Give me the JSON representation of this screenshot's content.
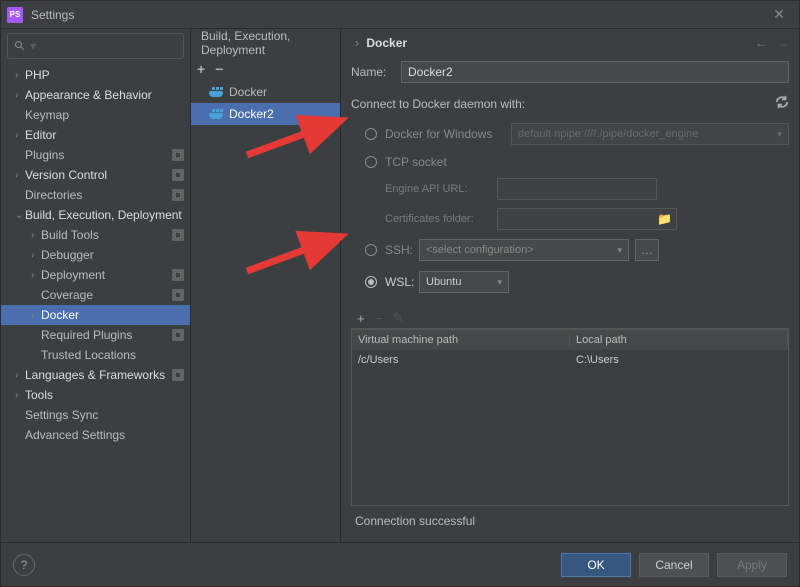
{
  "window": {
    "title": "Settings",
    "app_icon_text": "PS",
    "close_glyph": "✕"
  },
  "search": {
    "placeholder": ""
  },
  "tree": [
    {
      "label": "PHP",
      "level": 1,
      "arrow": "›",
      "bold": true,
      "scope": false
    },
    {
      "label": "Appearance & Behavior",
      "level": 1,
      "arrow": "›",
      "bold": true,
      "scope": false
    },
    {
      "label": "Keymap",
      "level": 1,
      "arrow": "",
      "bold": false,
      "scope": false
    },
    {
      "label": "Editor",
      "level": 1,
      "arrow": "›",
      "bold": true,
      "scope": false
    },
    {
      "label": "Plugins",
      "level": 1,
      "arrow": "",
      "bold": false,
      "scope": true
    },
    {
      "label": "Version Control",
      "level": 1,
      "arrow": "›",
      "bold": true,
      "scope": true
    },
    {
      "label": "Directories",
      "level": 1,
      "arrow": "",
      "bold": false,
      "scope": true
    },
    {
      "label": "Build, Execution, Deployment",
      "level": 1,
      "arrow": "⌄",
      "bold": true,
      "scope": false
    },
    {
      "label": "Build Tools",
      "level": 2,
      "arrow": "›",
      "bold": false,
      "scope": true
    },
    {
      "label": "Debugger",
      "level": 2,
      "arrow": "›",
      "bold": false,
      "scope": false
    },
    {
      "label": "Deployment",
      "level": 2,
      "arrow": "›",
      "bold": false,
      "scope": true
    },
    {
      "label": "Coverage",
      "level": 2,
      "arrow": "",
      "bold": false,
      "scope": true
    },
    {
      "label": "Docker",
      "level": 2,
      "arrow": "›",
      "bold": false,
      "scope": false,
      "selected": true
    },
    {
      "label": "Required Plugins",
      "level": 2,
      "arrow": "",
      "bold": false,
      "scope": true
    },
    {
      "label": "Trusted Locations",
      "level": 2,
      "arrow": "",
      "bold": false,
      "scope": false
    },
    {
      "label": "Languages & Frameworks",
      "level": 1,
      "arrow": "›",
      "bold": true,
      "scope": true
    },
    {
      "label": "Tools",
      "level": 1,
      "arrow": "›",
      "bold": true,
      "scope": false
    },
    {
      "label": "Settings Sync",
      "level": 1,
      "arrow": "",
      "bold": false,
      "scope": false
    },
    {
      "label": "Advanced Settings",
      "level": 1,
      "arrow": "",
      "bold": false,
      "scope": false
    }
  ],
  "breadcrumb": {
    "parent": "Build, Execution, Deployment",
    "sep": "›",
    "leaf": "Docker"
  },
  "nav": {
    "back": "←",
    "forward": "→"
  },
  "mid_toolbar": {
    "add": "+",
    "remove": "−"
  },
  "server_list": [
    {
      "label": "Docker",
      "selected": false
    },
    {
      "label": "Docker2",
      "selected": true
    }
  ],
  "form": {
    "name_label": "Name:",
    "name_value": "Docker2",
    "connect_label": "Connect to Docker daemon with:",
    "opt_windows": "Docker for Windows",
    "windows_default": "default  npipe:////./pipe/docker_engine",
    "opt_tcp": "TCP socket",
    "tcp_url_label": "Engine API URL:",
    "tcp_url_value": "",
    "tcp_cert_label": "Certificates folder:",
    "tcp_cert_value": "",
    "opt_ssh": "SSH:",
    "ssh_value": "<select configuration>",
    "ssh_dots": "…",
    "opt_wsl": "WSL:",
    "wsl_value": "Ubuntu",
    "path_add": "+",
    "path_remove": "−",
    "path_edit": "✎",
    "col_vm": "Virtual machine path",
    "col_local": "Local path",
    "paths": [
      {
        "vm": "/c/Users",
        "local": "C:\\Users"
      }
    ],
    "status": "Connection successful"
  },
  "footer": {
    "help": "?",
    "ok": "OK",
    "cancel": "Cancel",
    "apply": "Apply"
  }
}
